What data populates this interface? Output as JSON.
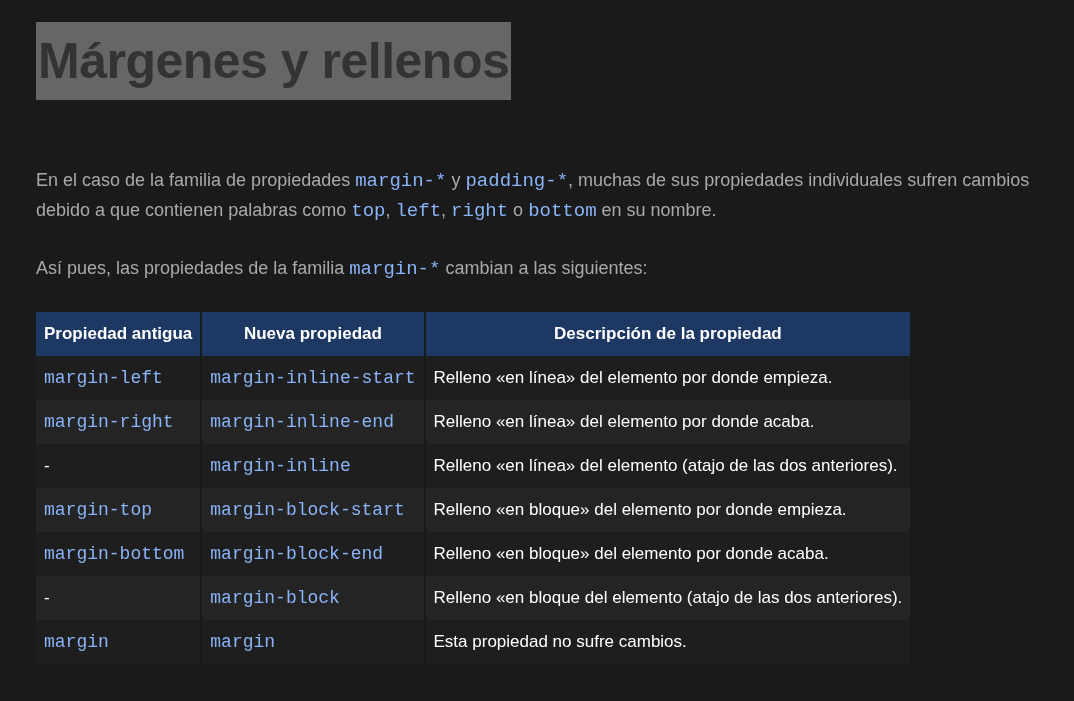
{
  "title": "Márgenes y rellenos",
  "paragraphs": [
    [
      {
        "kind": "text",
        "text": "En el caso de la familia de propiedades "
      },
      {
        "kind": "code",
        "text": "margin-*"
      },
      {
        "kind": "text",
        "text": " y "
      },
      {
        "kind": "code",
        "text": "padding-*"
      },
      {
        "kind": "text",
        "text": ", muchas de sus propiedades individuales sufren cambios debido a que contienen palabras como "
      },
      {
        "kind": "code",
        "text": "top"
      },
      {
        "kind": "text",
        "text": ", "
      },
      {
        "kind": "code",
        "text": "left"
      },
      {
        "kind": "text",
        "text": ", "
      },
      {
        "kind": "code",
        "text": "right"
      },
      {
        "kind": "text",
        "text": " o "
      },
      {
        "kind": "code",
        "text": "bottom"
      },
      {
        "kind": "text",
        "text": " en su nombre."
      }
    ],
    [
      {
        "kind": "text",
        "text": "Así pues, las propiedades de la familia "
      },
      {
        "kind": "code",
        "text": "margin-*"
      },
      {
        "kind": "text",
        "text": " cambian a las siguientes:"
      }
    ]
  ],
  "table": {
    "columns": [
      "Propiedad antigua",
      "Nueva propiedad",
      "Descripción de la propiedad"
    ],
    "rows": [
      [
        {
          "kind": "code",
          "text": "margin-left"
        },
        {
          "kind": "code",
          "text": "margin-inline-start"
        },
        {
          "kind": "text",
          "text": "Relleno «en línea» del elemento por donde empieza."
        }
      ],
      [
        {
          "kind": "code",
          "text": "margin-right"
        },
        {
          "kind": "code",
          "text": "margin-inline-end"
        },
        {
          "kind": "text",
          "text": "Relleno «en línea» del elemento por donde acaba."
        }
      ],
      [
        {
          "kind": "text",
          "text": "-"
        },
        {
          "kind": "code",
          "text": "margin-inline"
        },
        {
          "kind": "text",
          "text": "Relleno «en línea» del elemento (atajo de las dos anteriores)."
        }
      ],
      [
        {
          "kind": "code",
          "text": "margin-top"
        },
        {
          "kind": "code",
          "text": "margin-block-start"
        },
        {
          "kind": "text",
          "text": "Relleno «en bloque» del elemento por donde empieza."
        }
      ],
      [
        {
          "kind": "code",
          "text": "margin-bottom"
        },
        {
          "kind": "code",
          "text": "margin-block-end"
        },
        {
          "kind": "text",
          "text": "Relleno «en bloque» del elemento por donde acaba."
        }
      ],
      [
        {
          "kind": "text",
          "text": "-"
        },
        {
          "kind": "code",
          "text": "margin-block"
        },
        {
          "kind": "text",
          "text": "Relleno «en bloque del elemento (atajo de las dos anteriores)."
        }
      ],
      [
        {
          "kind": "code",
          "text": "margin"
        },
        {
          "kind": "code",
          "text": "margin"
        },
        {
          "kind": "text",
          "text": "Esta propiedad no sufre cambios."
        }
      ]
    ]
  }
}
